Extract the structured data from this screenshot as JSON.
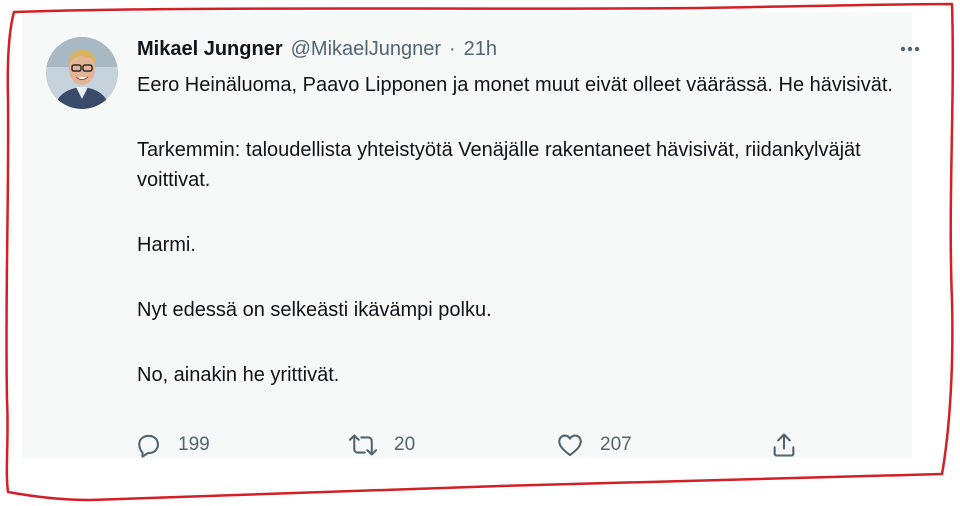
{
  "tweet": {
    "author_name": "Mikael Jungner",
    "author_handle": "@MikaelJungner",
    "separator": "·",
    "timestamp": "21h",
    "paragraphs": [
      "Eero Heinäluoma, Paavo Lipponen ja monet muut eivät olleet väärässä. He hävisivät.",
      "Tarkemmin: taloudellista yhteistyötä Venäjälle rakentaneet hävisivät, riidankylväjät voittivat.",
      "Harmi.",
      "Nyt edessä on selkeästi ikävämpi polku.",
      "No, ainakin he yrittivät."
    ],
    "actions": {
      "reply_count": "199",
      "retweet_count": "20",
      "like_count": "207"
    }
  },
  "icons": {
    "avatar": "avatar-photo",
    "more": "more-options-icon",
    "reply": "reply-icon",
    "retweet": "retweet-icon",
    "like": "heart-icon",
    "share": "share-icon"
  },
  "colors": {
    "card_background": "#f7f9f9",
    "primary_text": "#0f1419",
    "secondary_text": "#536471",
    "annotation_outline": "#d31f26"
  }
}
